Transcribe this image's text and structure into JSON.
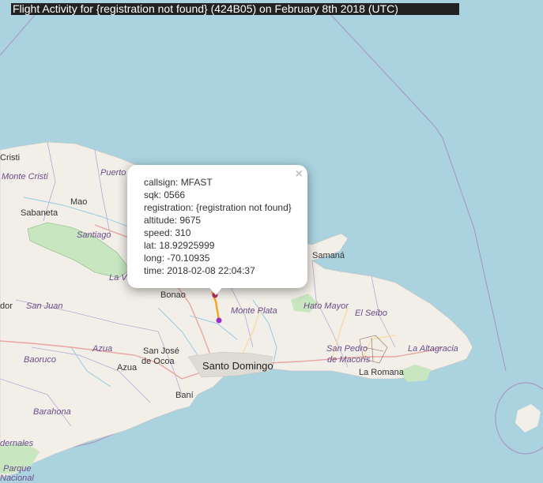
{
  "title": "Flight Activity for {registration not found} (424B05) on February 8th 2018 (UTC)",
  "popup": {
    "close": "×",
    "lines": [
      "callsign: MFAST",
      "sqk: 0566",
      "registration: {registration not found}",
      "altitude: 9675",
      "speed: 310",
      "lat: 18.92925999",
      "long: -70.10935",
      "time: 2018-02-08 22:04:37"
    ]
  },
  "places": {
    "cristi": "Cristi",
    "monte_cristi": "Monte Cristi",
    "puerto": "Puerto",
    "mao": "Mao",
    "sabaneta": "Sabaneta",
    "santiago": "Santiago",
    "la_vega": "La V",
    "bonao": "Bonao",
    "monte_plata": "Monte Plata",
    "samana": "Samaná",
    "hato_mayor": "Hato Mayor",
    "el_seibo": "El Seibo",
    "san_pedro": "San Pedro",
    "de_macoris": "de Macorís",
    "la_altagracia": "La Altagracia",
    "la_romana": "La Romana",
    "santo_domingo": "Santo Domingo",
    "san_jose": "San José",
    "de_ocoa": "de Ocoa",
    "azua_region": "Azua",
    "azua": "Azua",
    "bani": "Baní",
    "san_juan": "San Juan",
    "dor": "dor",
    "baoruco": "Baoruco",
    "barahona": "Barahona",
    "dernales": "dernales",
    "parque": "Parque",
    "nacional": "Nacional"
  },
  "colors": {
    "water": "#aad3df",
    "land": "#f2efe9",
    "park": "#c8e6c0",
    "track": "#f5a623",
    "marker_start": "#b03060",
    "marker_end": "#9b30c0",
    "boundary": "#a89ac8"
  }
}
